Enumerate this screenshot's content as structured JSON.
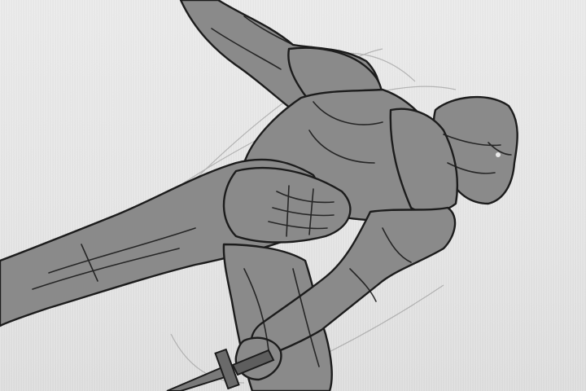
{
  "scene": {
    "subject": "sketch-of-masked-figure-with-sword",
    "colors": {
      "paper": "#e5e5e5",
      "fill": "#8a8a8a",
      "shadow": "#6e6e6e",
      "ink": "#1c1c1c",
      "guide": "#7a7a7a"
    }
  }
}
